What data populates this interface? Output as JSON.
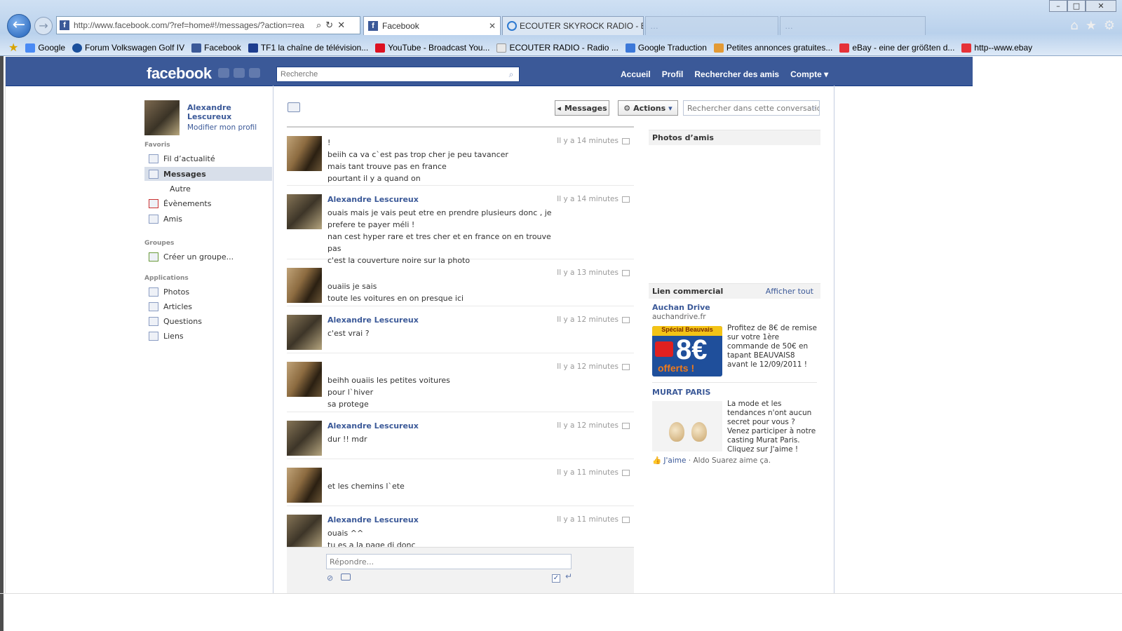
{
  "browser": {
    "url": "http://www.facebook.com/?ref=home#!/messages/?action=rea",
    "tabs": [
      {
        "label": "Facebook",
        "active": true
      },
      {
        "label": "ECOUTER SKYROCK RADIO - E...",
        "active": false
      },
      {
        "label": "…",
        "active": false
      },
      {
        "label": "…",
        "active": false
      }
    ],
    "favorites": [
      "Google",
      "Forum Volkswagen Golf IV",
      "Facebook",
      "TF1 la chaîne de télévision...",
      "YouTube - Broadcast You...",
      "ECOUTER RADIO - Radio ...",
      "Google Traduction",
      "Petites annonces gratuites...",
      "eBay - eine der größten d...",
      "http--www.ebay"
    ]
  },
  "fb": {
    "logo": "facebook",
    "search_placeholder": "Recherche",
    "nav": [
      "Accueil",
      "Profil",
      "Rechercher des amis",
      "Compte ▾"
    ]
  },
  "sidebar": {
    "name": "Alexandre Lescureux",
    "edit": "Modifier mon profil",
    "favoris": "Favoris",
    "items": [
      "Fil d’actualité",
      "Messages",
      "Autre",
      "Évènements",
      "Amis"
    ],
    "groupes": "Groupes",
    "create_group": "Créer un groupe...",
    "applications": "Applications",
    "apps": [
      "Photos",
      "Articles",
      "Questions",
      "Liens"
    ]
  },
  "toolbar": {
    "messages_label": "Messages",
    "actions_label": "Actions",
    "search_placeholder": "Rechercher dans cette conversatio"
  },
  "messages": [
    {
      "author": "",
      "time": "Il y a 14 minutes",
      "lines": [
        "!",
        "beiih ca va c`est pas trop cher je peu tavancer",
        "mais tant trouve pas en france",
        "pourtant il y a quand on"
      ]
    },
    {
      "author": "Alexandre Lescureux",
      "time": "Il y a 14 minutes",
      "lines": [
        "ouais mais je vais peut etre en prendre plusieurs donc , je prefere te payer méli !",
        "nan cest hyper rare et tres cher et en france on en trouve pas",
        "c'est la couverture noire sur la photo"
      ]
    },
    {
      "author": "",
      "time": "Il y a 13 minutes",
      "lines": [
        "ouaiis je sais",
        "toute les voitures en on presque ici"
      ]
    },
    {
      "author": "Alexandre Lescureux",
      "time": "Il y a 12 minutes",
      "lines": [
        "c'est vrai ?"
      ]
    },
    {
      "author": "",
      "time": "Il y a 12 minutes",
      "lines": [
        "beihh ouaiis les petites voitures",
        "pour l`hiver",
        "sa protege"
      ]
    },
    {
      "author": "Alexandre Lescureux",
      "time": "Il y a 12 minutes",
      "lines": [
        "dur !! mdr"
      ]
    },
    {
      "author": "",
      "time": "Il y a 11 minutes",
      "lines": [
        "et les chemins l`ete"
      ]
    },
    {
      "author": "Alexandre Lescureux",
      "time": "Il y a 11 minutes",
      "lines": [
        "ouais ^^",
        "tu es a la page di donc"
      ]
    }
  ],
  "composer": {
    "placeholder": "Répondre..."
  },
  "right": {
    "photos_title": "Photos d’amis",
    "ads_title": "Lien commercial",
    "ads_more": "Afficher tout",
    "ad1": {
      "title": "Auchan Drive",
      "domain": "auchandrive.fr",
      "text": "Profitez de 8€ de remise sur votre 1ère commande de 50€ en tapant BEAUVAIS8 avant le 12/09/2011 !",
      "banner_top": "Spécial Beauvais",
      "banner_big": "8€",
      "banner_bottom": "offerts !"
    },
    "ad2": {
      "title": "MURAT PARIS",
      "text": "La mode et les tendances n'ont aucun secret pour vous ? Venez participer à notre casting Murat Paris. Cliquez sur J'aime !"
    },
    "like": "J'aime",
    "like_rest": " · Aldo Suarez aime ça."
  }
}
